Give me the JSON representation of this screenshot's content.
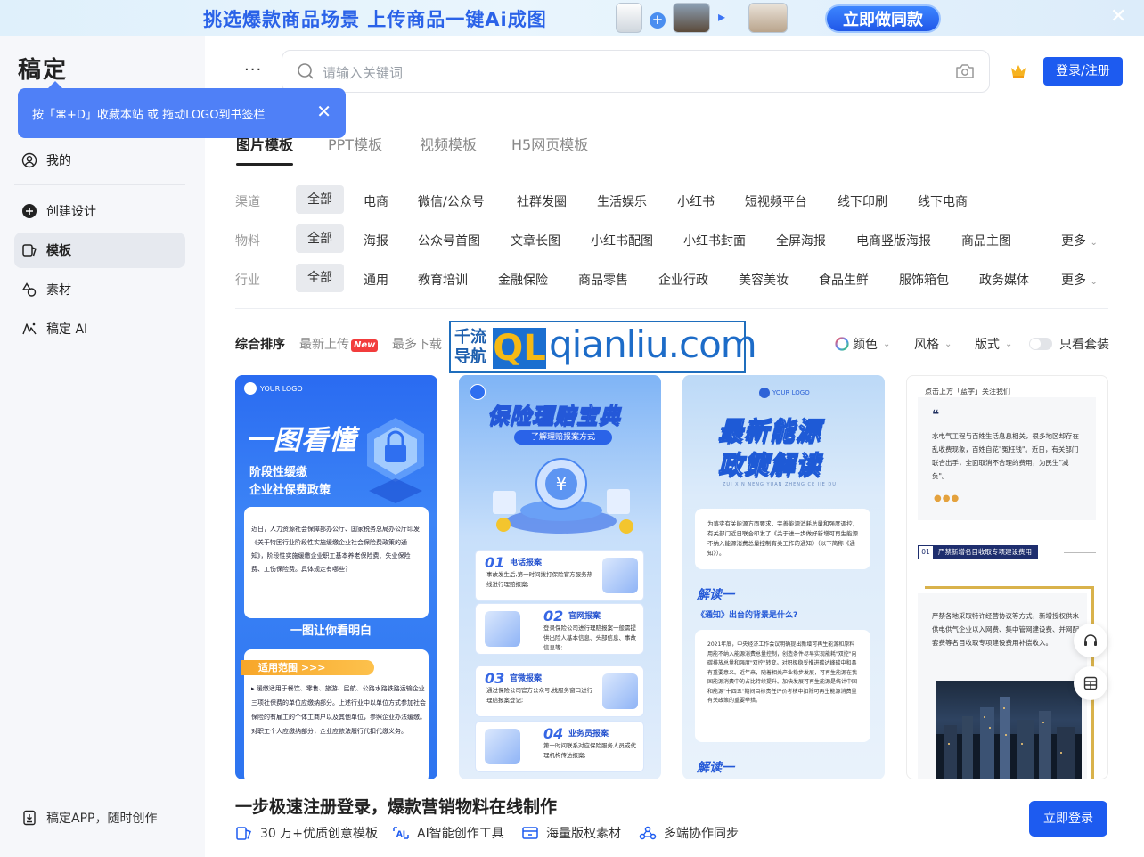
{
  "banner": {
    "text": "挑选爆款商品场景  上传商品一键Ai成图",
    "cta": "立即做同款",
    "close": "✕"
  },
  "sidebar": {
    "logo": "稿定",
    "tooltip": "按「⌘+D」收藏本站 或 拖动LOGO到书签栏",
    "items": [
      {
        "label": "我的",
        "icon": "user-icon"
      },
      {
        "label": "创建设计",
        "icon": "plus-circle-icon"
      },
      {
        "label": "模板",
        "icon": "template-icon",
        "active": true
      },
      {
        "label": "素材",
        "icon": "shapes-icon"
      },
      {
        "label": "稿定 AI",
        "icon": "ai-icon"
      }
    ],
    "app": "稿定APP，随时创作"
  },
  "header": {
    "more": "···",
    "search_placeholder": "请输入关键词",
    "login": "登录/注册"
  },
  "tabs": [
    "图片模板",
    "PPT模板",
    "视频模板",
    "H5网页模板"
  ],
  "filters": {
    "channel": {
      "label": "渠道",
      "items": [
        "全部",
        "电商",
        "微信/公众号",
        "社群发圈",
        "生活娱乐",
        "小红书",
        "短视频平台",
        "线下印刷",
        "线下电商"
      ]
    },
    "material": {
      "label": "物料",
      "items": [
        "全部",
        "海报",
        "公众号首图",
        "文章长图",
        "小红书配图",
        "小红书封面",
        "全屏海报",
        "电商竖版海报",
        "商品主图"
      ],
      "more": "更多"
    },
    "industry": {
      "label": "行业",
      "items": [
        "全部",
        "通用",
        "教育培训",
        "金融保险",
        "商品零售",
        "企业行政",
        "美容美妆",
        "食品生鲜",
        "服饰箱包",
        "政务媒体"
      ],
      "more": "更多"
    }
  },
  "sort": {
    "items": [
      "综合排序",
      "最新上传",
      "最多下载"
    ],
    "new_badge": "New",
    "color": "颜色",
    "style": "风格",
    "format": "版式",
    "only_set": "只看套装"
  },
  "watermark": {
    "cn": "千流导航",
    "ql": "QL",
    "url": "qianliu.com"
  },
  "cards": {
    "c1": {
      "logo": "YOUR LOGO",
      "title": "一图看懂",
      "subtitle1": "阶段性缓缴",
      "subtitle2": "企业社保费政策",
      "intro": "近日，人力资源社会保障部办公厅、国家税务总局办公厅印发《关于特困行业阶段性实施缓缴企业社会保险费政策的通知》，阶段性实施缓缴企业职工基本养老保险费、失业保险费、工伤保险费。具体规定有哪些？",
      "mid": "一图让你看明白",
      "tag": "适用范围 >>>",
      "body": "▸ 缓缴适用于餐饮、零售、旅游、民航、公路水路铁路运输企业三项社保费的单位应缴纳部分。上述行业中以单位方式参加社会保险的有雇工的个体工商户以及其他单位，参照企业办法缓缴。对职工个人应缴纳部分，企业应依法履行代扣代缴义务。"
    },
    "c2": {
      "title": "保险理赔宝典",
      "pill": "了解理赔报案方式",
      "items": [
        {
          "num": "01",
          "title": "电话报案",
          "desc": "事故发生后,第一时间拨打保险官方服务热线进行理赔报案;"
        },
        {
          "num": "02",
          "title": "官网报案",
          "desc": "登录保险公司进行理赔报案一般需提供出险人基本信息、头部信息、事故信息等;"
        },
        {
          "num": "03",
          "title": "官微报案",
          "desc": "通过保险公司官方公众号,找服务窗口进行理赔报案登记;"
        },
        {
          "num": "04",
          "title": "业务员报案",
          "desc": "第一时间联系对应保险服务人员或代理机构传达报案;"
        }
      ]
    },
    "c3": {
      "logo": "YOUR LOGO",
      "title1": "最新能源",
      "title2": "政策解读",
      "pinyin": "ZUI XIN NENG YUAN ZHENG CE JIE DU",
      "intro": "为落实有关能源方面要求，完善能源消耗总量和强度调控，有关部门近日联合印发了《关于进一步做好新增可再生能源不纳入能源消费总量控制有关工作的通知》（以下简称《通知》）。",
      "sec1": "解读一",
      "q1": "《通知》出台的背景是什么?",
      "body": "2021年底，中央经济工作会议明确提出新增可再生能源和原料用能不纳入能源消费总量控制，创造条件尽早实现能耗\"双控\"向碳排放总量和强度\"双控\"转变。对积极稳妥推进碳达峰碳中和具有重要意义。近年来，随着相关产业稳步发展，可再生能源在我国能源消费中的占比持续提升。加快发展可再生能源是统计中国和能源\"十四五\"期间目标责任评价考核中扣除可再生能源消费量有关政策的重要举措。",
      "sec2": "解读一"
    },
    "c4": {
      "head": "点击上方「蓝字」关注我们",
      "quote": "❝",
      "intro": "水电气工程与百姓生活息息相关，很多地区却存在乱收费现象，百姓自花\"冤枉钱\"。近日，有关部门联合出手，全面取消不合理的费用，为民生\"减负\"。",
      "tag_num": "01",
      "tag": "严禁新增名目收取专项建设费用",
      "body": "严禁各地采取特许经营协议等方式，新增授权供水供电供气企业以入网费、集中管网建设费、并网配套费等名目收取专项建设费用补偿收入。"
    }
  },
  "bottom": {
    "title": "一步极速注册登录，爆款营销物料在线制作",
    "features": [
      "30 万+优质创意模板",
      "AI智能创作工具",
      "海量版权素材",
      "多端协作同步"
    ],
    "cta": "立即登录"
  }
}
